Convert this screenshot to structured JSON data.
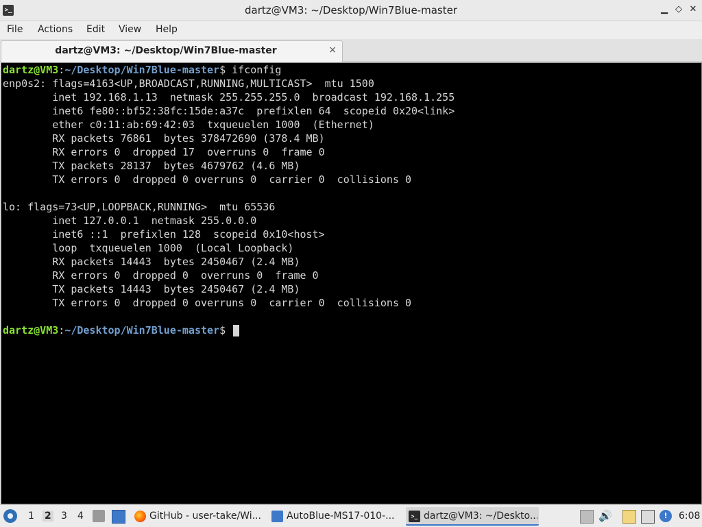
{
  "window": {
    "title": "dartz@VM3: ~/Desktop/Win7Blue-master",
    "minimize_glyph": "▁",
    "restore_glyph": "◇",
    "close_glyph": "✕"
  },
  "menu": {
    "file": "File",
    "actions": "Actions",
    "edit": "Edit",
    "view": "View",
    "help": "Help"
  },
  "tab": {
    "label": "dartz@VM3: ~/Desktop/Win7Blue-master",
    "close_glyph": "×"
  },
  "terminal": {
    "prompt": {
      "user_host": "dartz@VM3",
      "colon": ":",
      "path": "~/Desktop/Win7Blue-master",
      "dollar": "$ "
    },
    "command": "ifconfig",
    "output": [
      "enp0s2: flags=4163<UP,BROADCAST,RUNNING,MULTICAST>  mtu 1500",
      "        inet 192.168.1.13  netmask 255.255.255.0  broadcast 192.168.1.255",
      "        inet6 fe80::bf52:38fc:15de:a37c  prefixlen 64  scopeid 0x20<link>",
      "        ether c0:11:ab:69:42:03  txqueuelen 1000  (Ethernet)",
      "        RX packets 76861  bytes 378472690 (378.4 MB)",
      "        RX errors 0  dropped 17  overruns 0  frame 0",
      "        TX packets 28137  bytes 4679762 (4.6 MB)",
      "        TX errors 0  dropped 0 overruns 0  carrier 0  collisions 0",
      "",
      "lo: flags=73<UP,LOOPBACK,RUNNING>  mtu 65536",
      "        inet 127.0.0.1  netmask 255.0.0.0",
      "        inet6 ::1  prefixlen 128  scopeid 0x10<host>",
      "        loop  txqueuelen 1000  (Local Loopback)",
      "        RX packets 14443  bytes 2450467 (2.4 MB)",
      "        RX errors 0  dropped 0  overruns 0  frame 0",
      "        TX packets 14443  bytes 2450467 (2.4 MB)",
      "        TX errors 0  dropped 0 overruns 0  carrier 0  collisions 0",
      ""
    ]
  },
  "taskbar": {
    "workspaces": [
      "1",
      "2",
      "3",
      "4"
    ],
    "active_workspace": "2",
    "tasks": [
      {
        "label": "GitHub - user-take/Wi...",
        "icon": "firefox-icon"
      },
      {
        "label": "AutoBlue-MS17-010-...",
        "icon": "folder-icon"
      },
      {
        "label": "dartz@VM3: ~/Deskto...",
        "icon": "terminal-icon"
      }
    ],
    "volume_glyph": "🔊",
    "info_glyph": "!",
    "clock": "6:08"
  },
  "colors": {
    "terminal_bg": "#000000",
    "prompt_user": "#8ae234",
    "prompt_path": "#729fcf",
    "text": "#d6d6d6"
  }
}
